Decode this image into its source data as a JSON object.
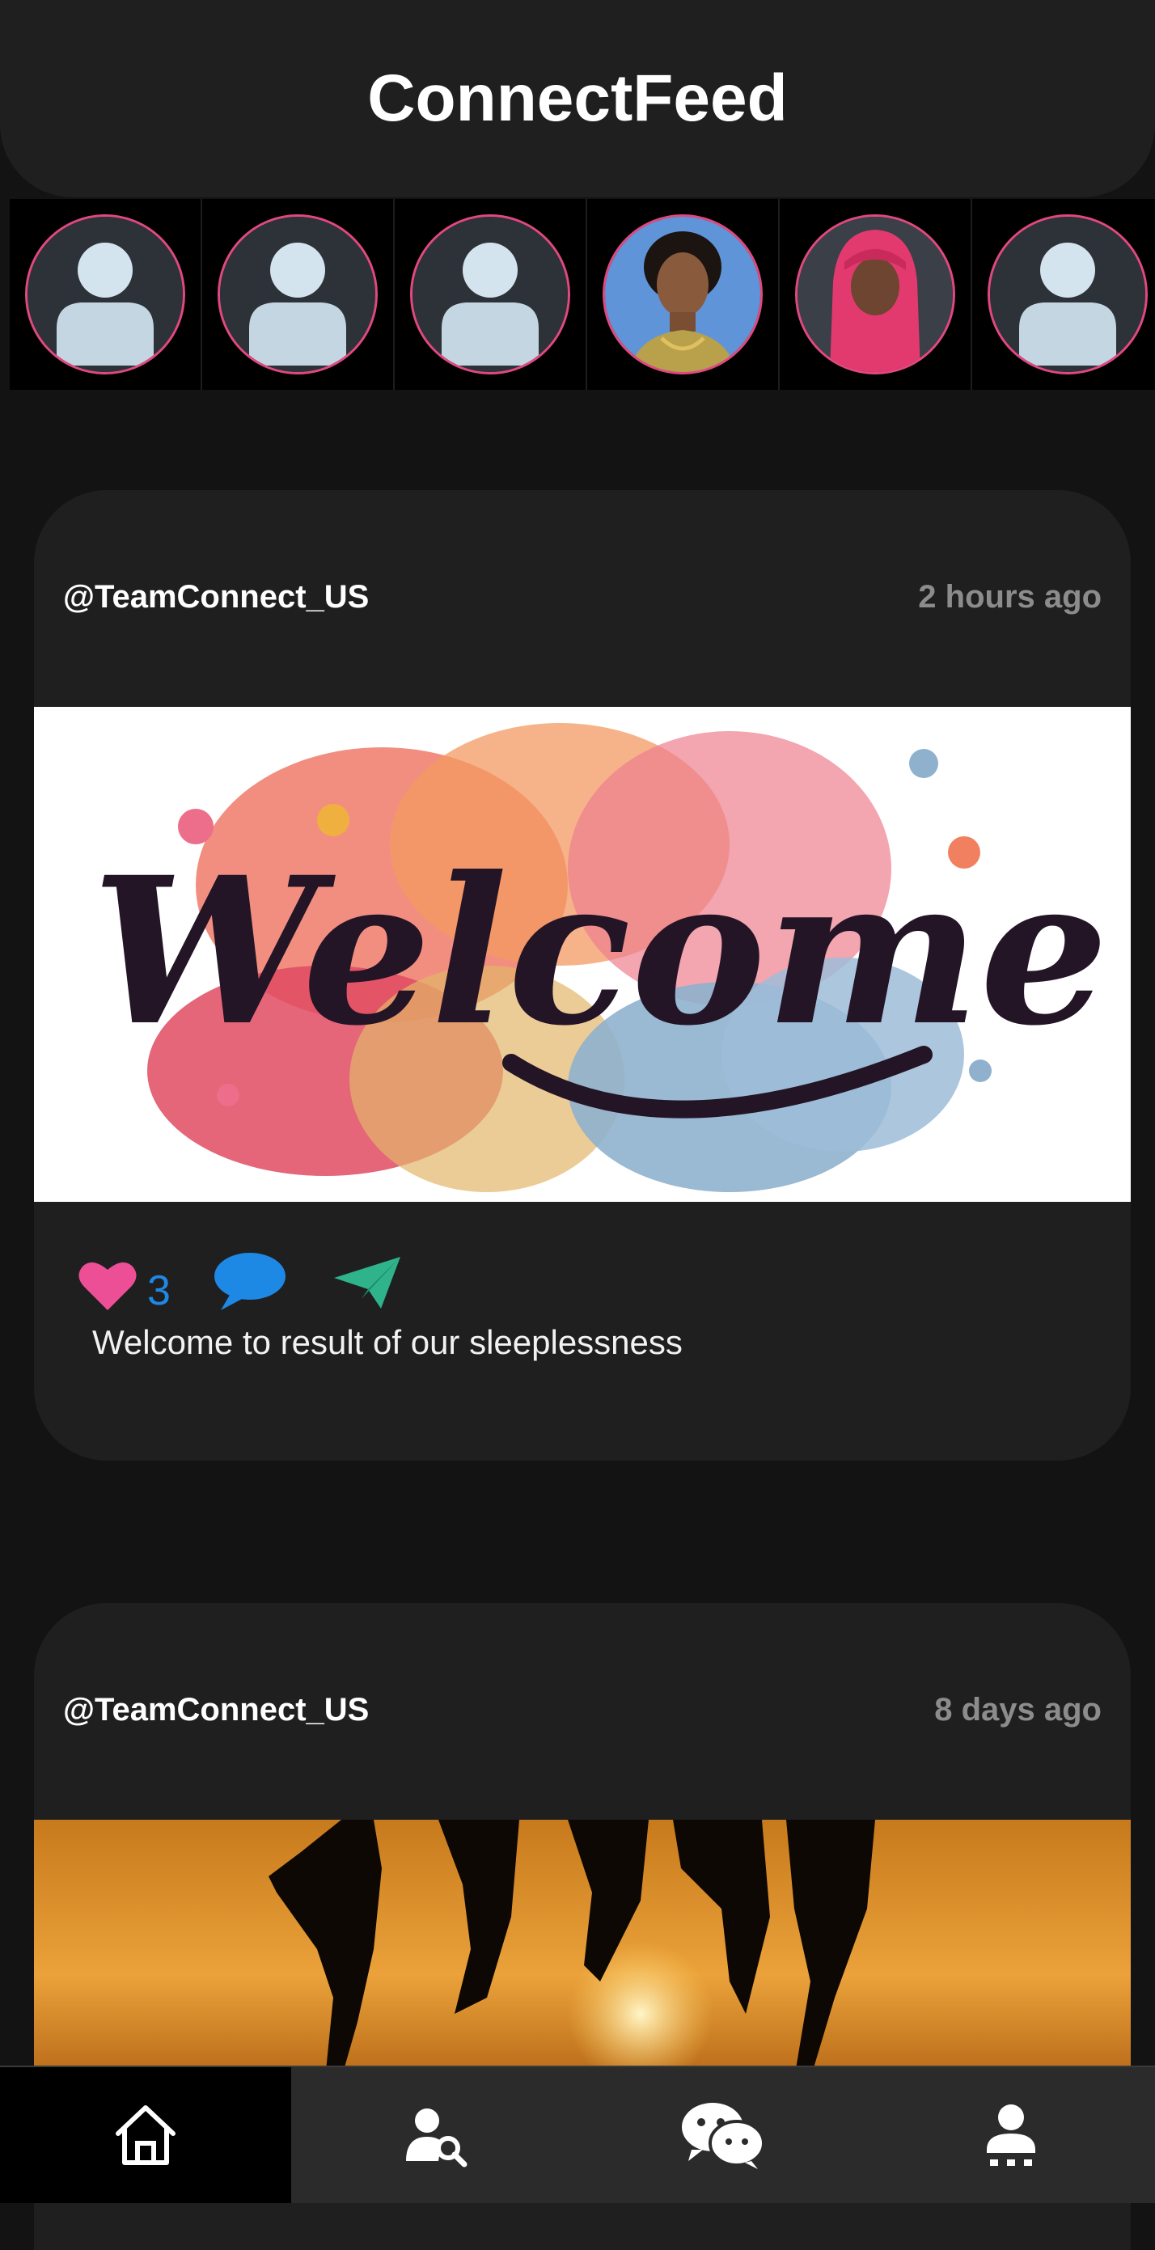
{
  "app": {
    "title": "ConnectFeed"
  },
  "stories": [
    {
      "type": "placeholder-avatar"
    },
    {
      "type": "placeholder-avatar"
    },
    {
      "type": "placeholder-avatar"
    },
    {
      "type": "photo-avatar"
    },
    {
      "type": "photo-avatar"
    },
    {
      "type": "placeholder-avatar"
    }
  ],
  "posts": [
    {
      "username": "@TeamConnect_US",
      "time": "2 hours ago",
      "image": "welcome-lettering-image",
      "image_text": "Welcome",
      "likes": "3",
      "caption": "Welcome to result of our sleeplessness"
    },
    {
      "username": "@TeamConnect_US",
      "time": "8 days ago",
      "image": "sunset-silhouettes-image"
    }
  ],
  "nav": {
    "items": [
      "home-icon",
      "user-search-icon",
      "chat-icon",
      "profile-icon"
    ],
    "active": "home-icon"
  },
  "colors": {
    "background": "#131313",
    "card": "#1f1f1f",
    "accent_pink": "#e2487f",
    "like_pink": "#ec4f96",
    "comment_blue": "#1e88e5",
    "share_green": "#2fb38a",
    "muted_text": "#8c8c8c"
  }
}
